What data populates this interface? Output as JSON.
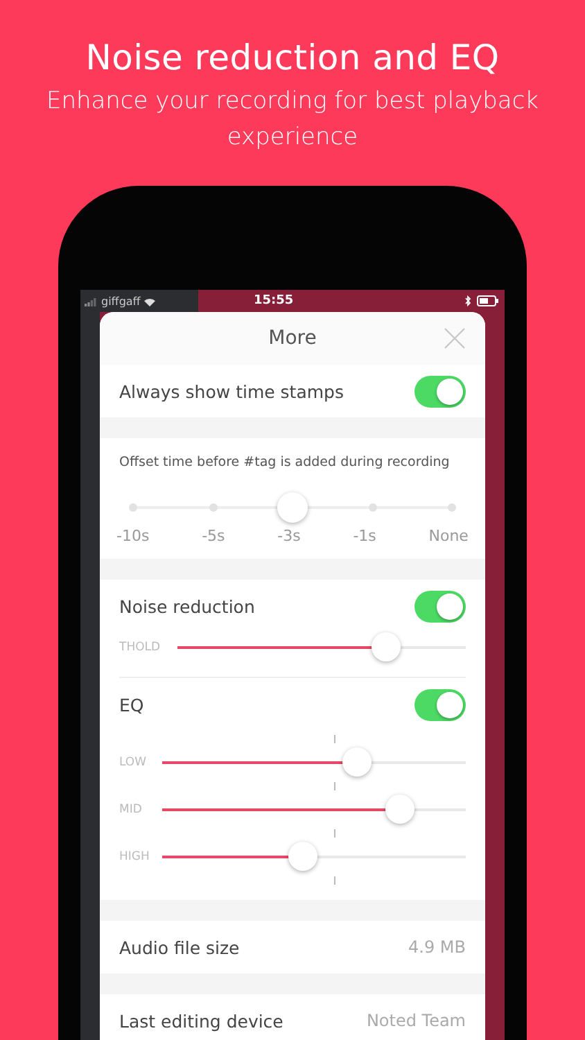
{
  "headline": "Noise reduction and EQ",
  "subheadline": "Enhance your recording for best playback experience",
  "status_bar": {
    "carrier": "giffgaff",
    "time": "15:55"
  },
  "modal": {
    "title": "More",
    "timestamps": {
      "label": "Always show time stamps",
      "on": true
    },
    "offset": {
      "label": "Offset time before #tag is added during recording",
      "stops": [
        {
          "label": "-10s",
          "selected": false
        },
        {
          "label": "-5s",
          "selected": false
        },
        {
          "label": "-3s",
          "selected": true
        },
        {
          "label": "-1s",
          "selected": false
        },
        {
          "label": "None",
          "selected": false
        }
      ]
    },
    "noise_reduction": {
      "label": "Noise reduction",
      "on": true,
      "sliders": [
        {
          "label": "THOLD",
          "level": 0.72
        }
      ]
    },
    "eq": {
      "label": "EQ",
      "on": true,
      "sliders": [
        {
          "label": "LOW",
          "level": 0.64
        },
        {
          "label": "MID",
          "level": 0.78
        },
        {
          "label": "HIGH",
          "level": 0.46
        }
      ]
    },
    "info_rows": [
      {
        "label": "Audio file size",
        "value": "4.9 MB"
      },
      {
        "label": "Last editing device",
        "value": "Noted Team"
      }
    ]
  }
}
